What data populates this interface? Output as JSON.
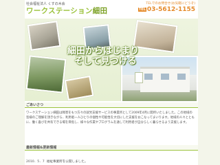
{
  "header": {
    "org": "社会福祉法人 くすの木会",
    "logo_main": "ワークステーション",
    "logo_tail": "細田",
    "tagline": "TELでのお問合せ(お気軽にどうぞ)",
    "tel_badge": "TEL",
    "phone": "03-5612-1155"
  },
  "hero": {
    "slogan_line1": "細田からはじまり",
    "slogan_line2": "そして見つける"
  },
  "intro": {
    "heading": "ごあいさつ",
    "body": "ワークステーション細田は障害をもつ方々の就労支援サービスの事業所として2009年4月に開所いたしました。この地域の皆様のご理解を頂きながら、利用者一人ひとりの個性や可能性を大切にした支援をおこなってまいります。地域の人々とともに、働く喜びを共有できる場を目指し、様々な作業やプログラムを通して利用者が自分らしく暮らせるよう支援します。"
  },
  "news": {
    "heading": "最新情報&更新情報",
    "items": [
      {
        "date": "2010．5．7",
        "text": "福祉事業所を公開しました。"
      }
    ]
  }
}
